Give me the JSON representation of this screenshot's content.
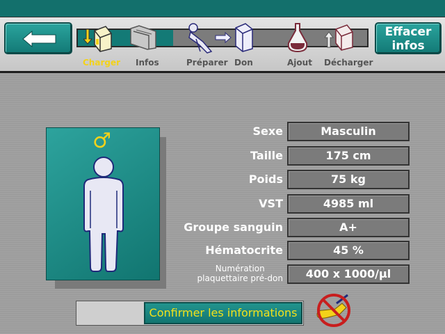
{
  "header": {
    "clear_button": "Effacer\ninfos"
  },
  "workflow": {
    "steps": [
      {
        "label": "Charger",
        "state": "active",
        "icon": "load-disposable-icon"
      },
      {
        "label": "Infos",
        "state": "pending",
        "icon": "info-folder-icon"
      },
      {
        "label": "Préparer",
        "state": "pending",
        "icon": "prepare-donor-icon"
      },
      {
        "label": "Don",
        "state": "pending",
        "icon": "donation-icon"
      },
      {
        "label": "Ajout",
        "state": "pending",
        "icon": "add-bag-icon"
      },
      {
        "label": "Décharger",
        "state": "pending",
        "icon": "unload-disposable-icon"
      }
    ],
    "progress_fraction": 0.33,
    "colors": {
      "active": "#f3d21a",
      "inactive": "#555555",
      "progress": "#137a76"
    }
  },
  "donor": {
    "gender_symbol": "♂",
    "fields": [
      {
        "label": "Sexe",
        "value": "Masculin"
      },
      {
        "label": "Taille",
        "value": "175 cm"
      },
      {
        "label": "Poids",
        "value": "75 kg"
      },
      {
        "label": "VST",
        "value": "4985 ml"
      },
      {
        "label": "Groupe sanguin",
        "value": "A+"
      },
      {
        "label": "Hématocrite",
        "value": "45 %"
      },
      {
        "label": "Numération\nplaquettaire pré-don",
        "value": "400 x 1000/µl"
      }
    ]
  },
  "footer": {
    "confirm_label": "Confirmer les informations",
    "no_arm_icon": "no-arm-connected-icon"
  },
  "colors": {
    "accent": "#137a76",
    "highlight_text": "#f3e11a"
  }
}
